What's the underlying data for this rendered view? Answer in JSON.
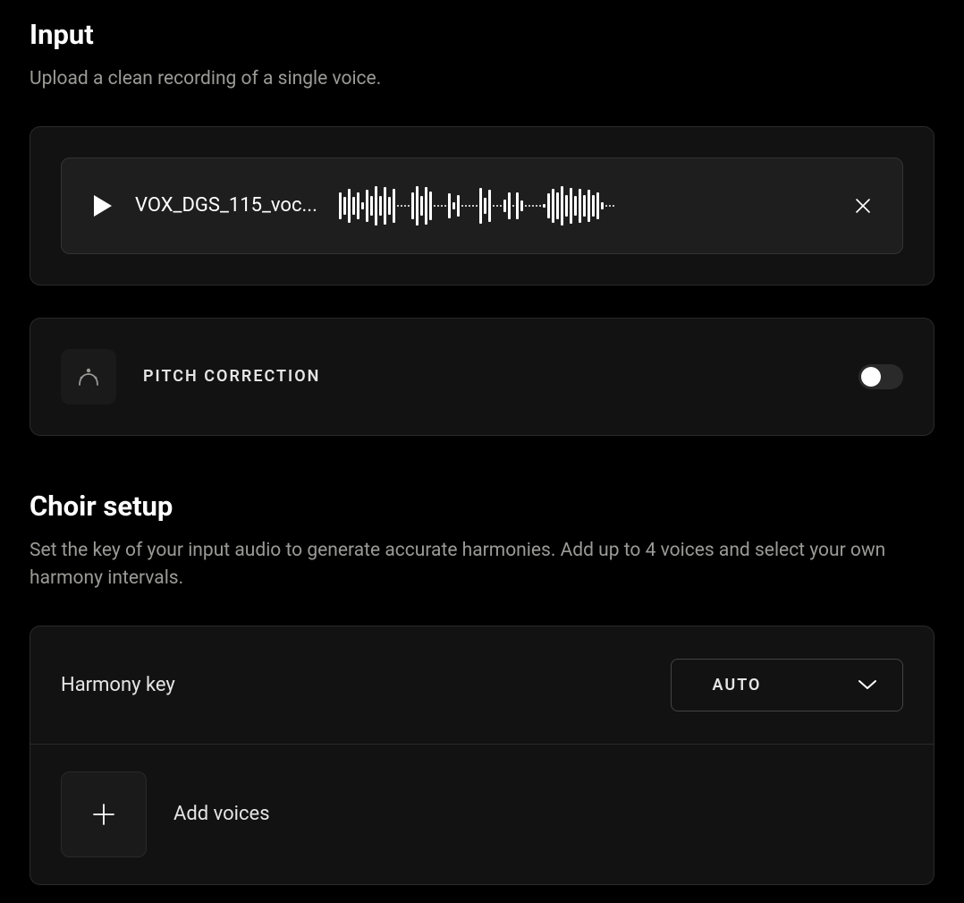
{
  "input": {
    "title": "Input",
    "subtitle": "Upload a clean recording of a single voice.",
    "filename": "VOX_DGS_115_voc...",
    "waveform_heights": [
      30,
      20,
      38,
      20,
      30,
      8,
      36,
      22,
      44,
      22,
      42,
      20,
      38,
      2,
      2,
      2,
      2,
      30,
      44,
      22,
      42,
      32,
      2,
      2,
      2,
      2,
      28,
      8,
      24,
      2,
      2,
      2,
      2,
      2,
      40,
      18,
      36,
      2,
      2,
      2,
      14,
      30,
      2,
      30,
      12,
      2,
      2,
      2,
      2,
      2,
      4,
      28,
      38,
      30,
      44,
      24,
      40,
      22,
      38,
      24,
      36,
      24,
      30,
      8,
      2,
      2,
      2
    ],
    "pitch_correction_label": "PITCH CORRECTION"
  },
  "choir": {
    "title": "Choir setup",
    "subtitle": "Set the key of your input audio to generate accurate harmonies. Add up to 4 voices and select your own harmony intervals.",
    "harmony_key_label": "Harmony key",
    "harmony_key_value": "AUTO",
    "add_voices_label": "Add voices"
  }
}
